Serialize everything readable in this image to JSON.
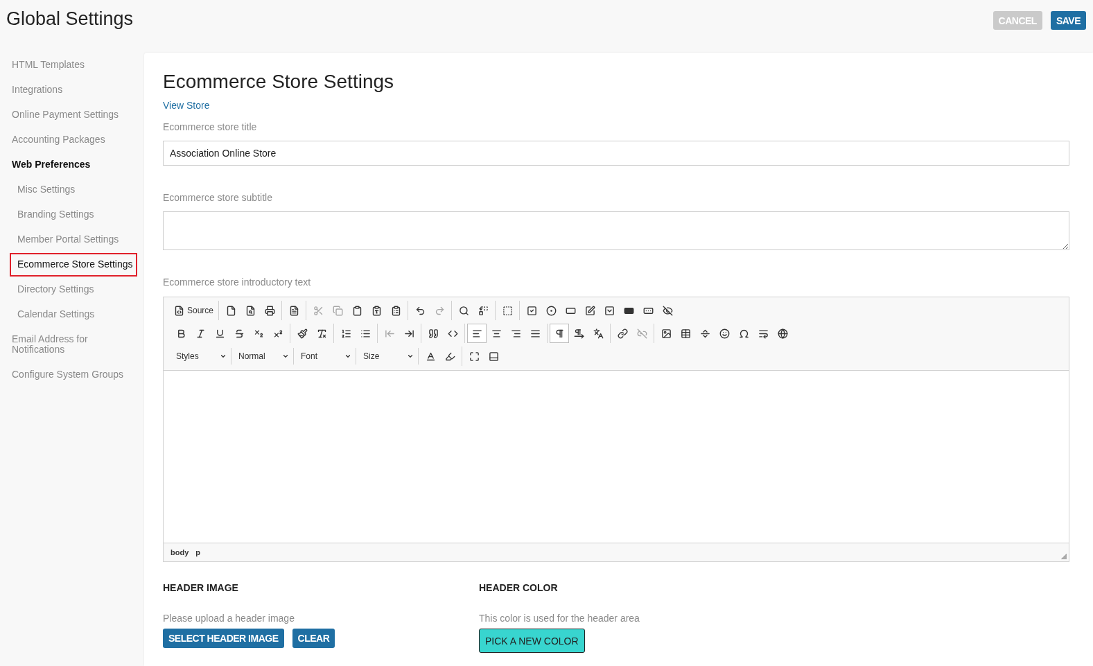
{
  "page_title": "Global Settings",
  "actions": [
    {
      "kind": "cancel",
      "label": "CANCEL",
      "disabled": true
    },
    {
      "kind": "save",
      "label": "SAVE",
      "disabled": false
    }
  ],
  "sidebar": {
    "items": [
      {
        "label": "HTML Templates",
        "selected": false
      },
      {
        "label": "Integrations",
        "selected": false
      },
      {
        "label": "Online Payment Settings",
        "selected": false
      },
      {
        "label": "Accounting Packages",
        "selected": false
      },
      {
        "label": "Web Preferences",
        "selected": false,
        "expanded": true,
        "children": [
          {
            "label": "Misc Settings",
            "selected": false
          },
          {
            "label": "Branding Settings",
            "selected": false
          },
          {
            "label": "Member Portal Settings",
            "selected": false
          },
          {
            "label": "Ecommerce Store Settings",
            "selected": true
          },
          {
            "label": "Directory Settings",
            "selected": false
          },
          {
            "label": "Calendar Settings",
            "selected": false
          }
        ]
      },
      {
        "label": "Email Address for Notifications",
        "selected": false
      },
      {
        "label": "Configure System Groups",
        "selected": false
      }
    ]
  },
  "form": {
    "title": "Ecommerce Store Settings",
    "link": "View Store",
    "store_title": {
      "label": "Ecommerce store title",
      "value": "Association Online Store"
    },
    "store_subtitle": {
      "label": "Ecommerce store subtitle"
    },
    "intro_text": {
      "label": "Ecommerce store introductory text",
      "toolbar": [
        [
          [
            {
              "kind": "source",
              "label": "Source",
              "disabled": false,
              "selected": false
            }
          ],
          [
            {
              "kind": "new-page",
              "disabled": false,
              "selected": false
            },
            {
              "kind": "preview",
              "disabled": false,
              "selected": false
            },
            {
              "kind": "print",
              "disabled": false,
              "selected": false
            }
          ],
          [
            {
              "kind": "templates",
              "disabled": false,
              "selected": false
            }
          ],
          [
            {
              "kind": "cut",
              "disabled": true,
              "selected": false
            },
            {
              "kind": "copy",
              "disabled": true,
              "selected": false
            },
            {
              "kind": "paste",
              "disabled": false,
              "selected": false
            },
            {
              "kind": "paste-text",
              "disabled": false,
              "selected": false
            },
            {
              "kind": "paste-word",
              "disabled": false,
              "selected": false
            }
          ],
          [
            {
              "kind": "undo",
              "disabled": false,
              "selected": false
            },
            {
              "kind": "redo",
              "disabled": true,
              "selected": false
            }
          ],
          [
            {
              "kind": "find",
              "disabled": false,
              "selected": false
            },
            {
              "kind": "replace",
              "disabled": false,
              "selected": false
            }
          ],
          [
            {
              "kind": "select-all",
              "disabled": false,
              "selected": false
            }
          ],
          [
            {
              "kind": "checkbox",
              "disabled": false,
              "selected": false
            },
            {
              "kind": "radio",
              "disabled": false,
              "selected": false
            },
            {
              "kind": "text-field",
              "disabled": false,
              "selected": false
            },
            {
              "kind": "textarea",
              "disabled": false,
              "selected": false
            },
            {
              "kind": "select",
              "disabled": false,
              "selected": false
            },
            {
              "kind": "button",
              "disabled": false,
              "selected": false
            },
            {
              "kind": "image-button",
              "disabled": false,
              "selected": false
            },
            {
              "kind": "hidden-field",
              "disabled": false,
              "selected": false
            }
          ]
        ],
        [
          [
            {
              "kind": "bold",
              "disabled": false,
              "selected": false
            },
            {
              "kind": "italic",
              "disabled": false,
              "selected": false
            },
            {
              "kind": "underline",
              "disabled": false,
              "selected": false
            },
            {
              "kind": "strike",
              "disabled": false,
              "selected": false
            },
            {
              "kind": "subscript",
              "disabled": false,
              "selected": false
            },
            {
              "kind": "superscript",
              "disabled": false,
              "selected": false
            }
          ],
          [
            {
              "kind": "copy-format",
              "disabled": false,
              "selected": false
            },
            {
              "kind": "remove-format",
              "disabled": false,
              "selected": false
            }
          ],
          [
            {
              "kind": "numbered-list",
              "disabled": false,
              "selected": false
            },
            {
              "kind": "bulleted-list",
              "disabled": false,
              "selected": false
            }
          ],
          [
            {
              "kind": "outdent",
              "disabled": true,
              "selected": false
            },
            {
              "kind": "indent",
              "disabled": false,
              "selected": false
            }
          ],
          [
            {
              "kind": "blockquote",
              "disabled": false,
              "selected": false
            },
            {
              "kind": "div",
              "disabled": false,
              "selected": false
            }
          ],
          [
            {
              "kind": "align-left",
              "disabled": false,
              "selected": true
            },
            {
              "kind": "align-center",
              "disabled": false,
              "selected": false
            },
            {
              "kind": "align-right",
              "disabled": false,
              "selected": false
            },
            {
              "kind": "justify",
              "disabled": false,
              "selected": false
            }
          ],
          [
            {
              "kind": "ltr",
              "disabled": false,
              "selected": true
            },
            {
              "kind": "rtl",
              "disabled": false,
              "selected": false
            },
            {
              "kind": "language",
              "disabled": false,
              "selected": false
            }
          ],
          [
            {
              "kind": "link",
              "disabled": false,
              "selected": false
            },
            {
              "kind": "unlink",
              "disabled": true,
              "selected": false
            }
          ],
          [
            {
              "kind": "image",
              "disabled": false,
              "selected": false
            },
            {
              "kind": "table",
              "disabled": false,
              "selected": false
            },
            {
              "kind": "hr",
              "disabled": false,
              "selected": false
            },
            {
              "kind": "smiley",
              "disabled": false,
              "selected": false
            },
            {
              "kind": "special-char",
              "disabled": false,
              "selected": false
            },
            {
              "kind": "page-break",
              "disabled": false,
              "selected": false
            },
            {
              "kind": "iframe",
              "disabled": false,
              "selected": false
            }
          ]
        ],
        [
          [
            {
              "kind": "combo",
              "label": "Styles"
            },
            {
              "kind": "combo",
              "label": "Normal"
            },
            {
              "kind": "combo",
              "label": "Font"
            },
            {
              "kind": "combo",
              "label": "Size"
            }
          ],
          [
            {
              "kind": "text-color",
              "disabled": false,
              "selected": false
            },
            {
              "kind": "bg-color",
              "disabled": false,
              "selected": false
            }
          ],
          [
            {
              "kind": "maximize",
              "disabled": false,
              "selected": false
            },
            {
              "kind": "show-blocks",
              "disabled": false,
              "selected": false
            }
          ]
        ]
      ],
      "path": [
        "body",
        "p"
      ]
    },
    "header_image": {
      "heading": "HEADER IMAGE",
      "hint": "Please upload a header image",
      "buttons": [
        {
          "kind": "primary",
          "label": "SELECT HEADER IMAGE"
        },
        {
          "kind": "primary",
          "label": "CLEAR"
        }
      ]
    },
    "header_color": {
      "heading": "HEADER COLOR",
      "hint": "This color is used for the header area",
      "buttons": [
        {
          "kind": "color",
          "label": "PICK A NEW COLOR"
        }
      ]
    }
  }
}
